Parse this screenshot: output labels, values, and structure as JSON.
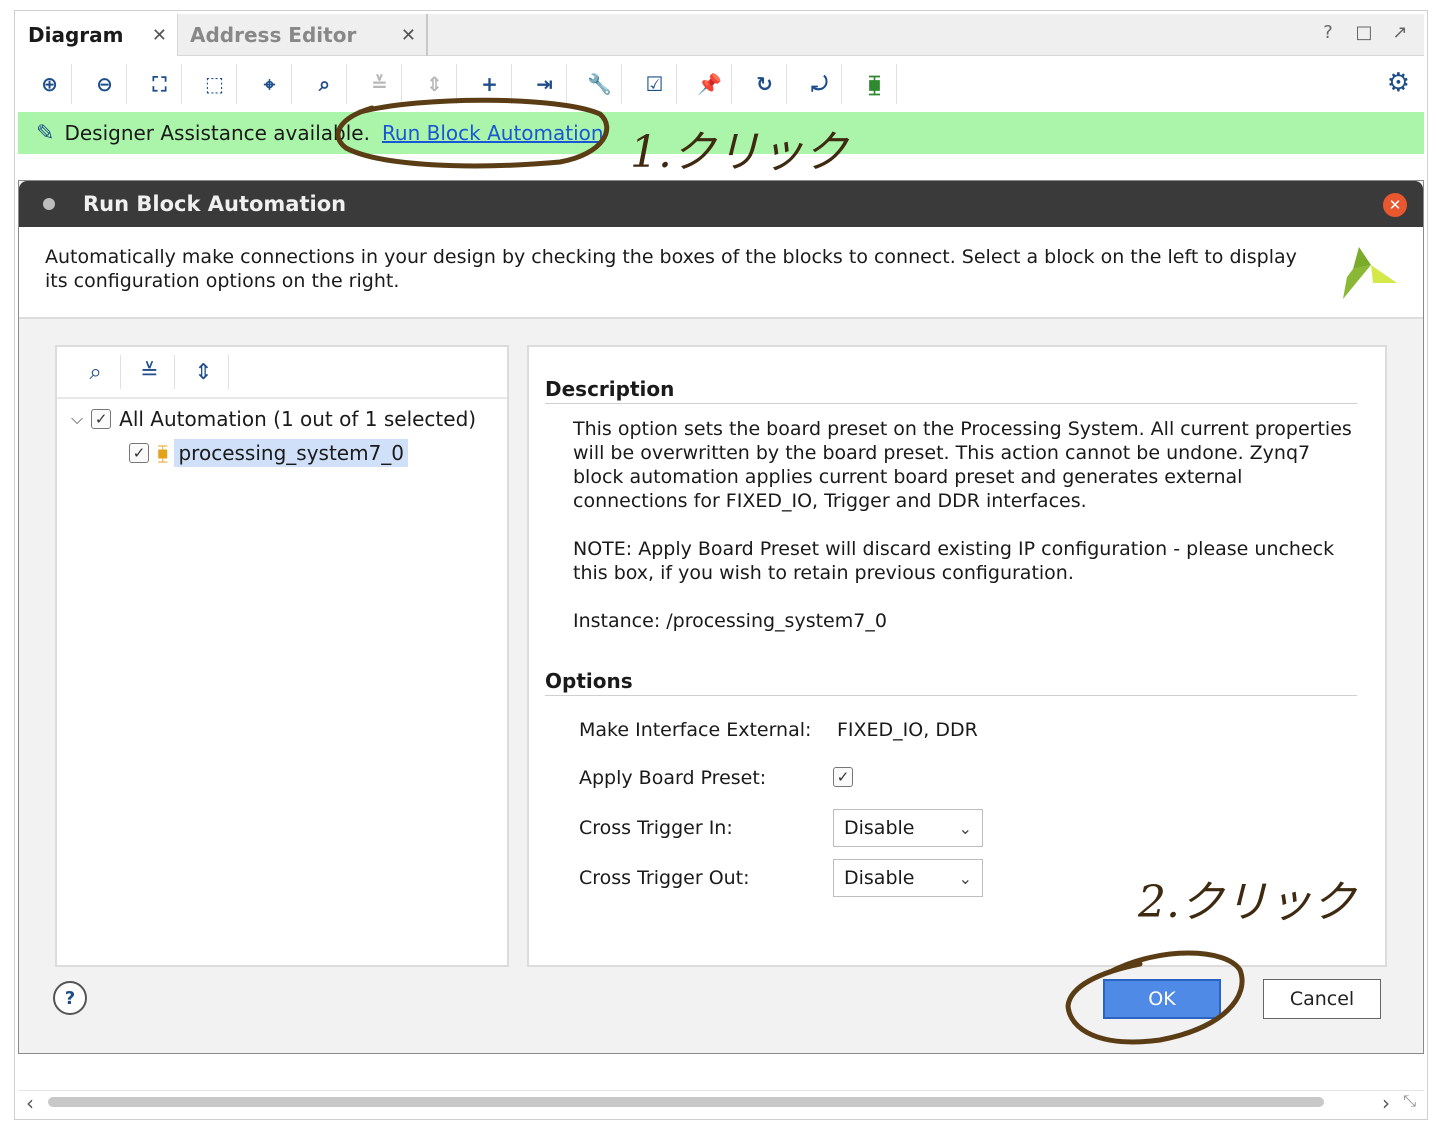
{
  "tabs": [
    {
      "label": "Diagram",
      "active": true
    },
    {
      "label": "Address Editor",
      "active": false
    }
  ],
  "window_controls": [
    "?",
    "□",
    "↗"
  ],
  "assist": {
    "text": "Designer Assistance available.",
    "link": "Run Block Automation"
  },
  "dialog": {
    "title": "Run Block Automation",
    "intro": "Automatically make connections in your design by checking the boxes of the blocks to connect. Select a block on the left to display its configuration options on the right.",
    "tree": {
      "root_label": "All Automation (1 out of 1 selected)",
      "root_checked": true,
      "child_label": "processing_system7_0",
      "child_checked": true
    },
    "description_title": "Description",
    "description_paragraphs": [
      "This option sets the board preset on the Processing System. All current properties will be overwritten by the board preset. This action cannot be undone. Zynq7 block automation applies current board preset and generates external connections for FIXED_IO, Trigger and DDR interfaces.",
      "NOTE: Apply Board Preset will discard existing IP configuration - please uncheck this box, if you wish to retain previous configuration.",
      "Instance: /processing_system7_0"
    ],
    "options_title": "Options",
    "options": {
      "make_interface_label": "Make Interface External:",
      "make_interface_value": "FIXED_IO, DDR",
      "apply_board_preset_label": "Apply Board Preset:",
      "apply_board_preset_checked": true,
      "cross_trigger_in_label": "Cross Trigger In:",
      "cross_trigger_in_value": "Disable",
      "cross_trigger_out_label": "Cross Trigger Out:",
      "cross_trigger_out_value": "Disable"
    },
    "buttons": {
      "ok": "OK",
      "cancel": "Cancel"
    }
  },
  "annotations": {
    "step1": "1.クリック",
    "step2": "2.クリック",
    "color": "#5a3d14"
  }
}
